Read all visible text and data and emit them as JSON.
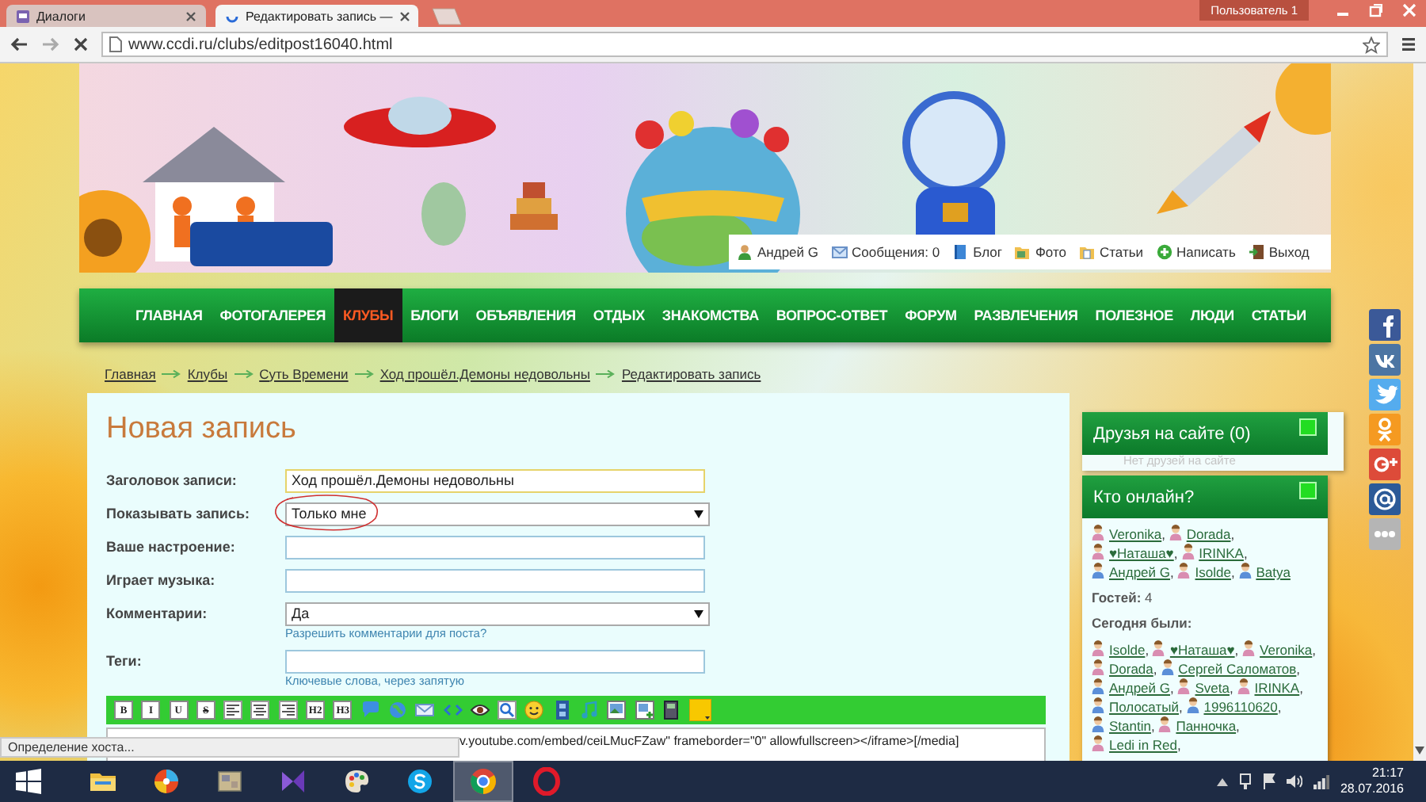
{
  "browser": {
    "tabs": [
      {
        "title": "Диалоги",
        "selected": false
      },
      {
        "title": "Редактировать запись —",
        "selected": true
      }
    ],
    "profile": "Пользователь 1",
    "url": "www.ccdi.ru/clubs/editpost16040.html"
  },
  "user_bar": [
    {
      "kind": "user",
      "label": "Андрей G"
    },
    {
      "kind": "messages",
      "label": "Сообщения: 0"
    },
    {
      "kind": "blog",
      "label": "Блог"
    },
    {
      "kind": "photo",
      "label": "Фото"
    },
    {
      "kind": "articles",
      "label": "Статьи"
    },
    {
      "kind": "write",
      "label": "Написать"
    },
    {
      "kind": "logout",
      "label": "Выход"
    }
  ],
  "nav": [
    {
      "label": "ГЛАВНАЯ",
      "selected": false
    },
    {
      "label": "ФОТОГАЛЕРЕЯ",
      "selected": false
    },
    {
      "label": "КЛУБЫ",
      "selected": true
    },
    {
      "label": "БЛОГИ",
      "selected": false
    },
    {
      "label": "ОБЪЯВЛЕНИЯ",
      "selected": false
    },
    {
      "label": "ОТДЫХ",
      "selected": false
    },
    {
      "label": "ЗНАКОМСТВА",
      "selected": false
    },
    {
      "label": "ВОПРОС-ОТВЕТ",
      "selected": false
    },
    {
      "label": "ФОРУМ",
      "selected": false
    },
    {
      "label": "РАЗВЛЕЧЕНИЯ",
      "selected": false
    },
    {
      "label": "ПОЛЕЗНОЕ",
      "selected": false
    },
    {
      "label": "ЛЮДИ",
      "selected": false
    },
    {
      "label": "СТАТЬИ",
      "selected": false
    }
  ],
  "breadcrumbs": [
    "Главная",
    "Клубы",
    "Суть Времени",
    "Ход прошёл.Демоны недовольны",
    "Редактировать запись"
  ],
  "form": {
    "title": "Новая запись",
    "fields": [
      {
        "kind": "text",
        "label": "Заголовок записи:",
        "value": "Ход прошёл.Демоны недовольны",
        "focused": true
      },
      {
        "kind": "select",
        "label": "Показывать запись:",
        "value": "Только мне",
        "circled": true
      },
      {
        "kind": "text",
        "label": "Ваше настроение:",
        "focused": false
      },
      {
        "kind": "text",
        "label": "Играет музыка:",
        "focused": false
      },
      {
        "kind": "select",
        "label": "Комментарии:",
        "value": "Да",
        "hint": "Разрешить комментарии для поста?",
        "circled": false
      },
      {
        "kind": "text",
        "label": "Теги:",
        "hint": "Ключевые слова, через запятую",
        "focused": false
      }
    ],
    "toolbar": [
      {
        "kind": "letter",
        "label": "B"
      },
      {
        "kind": "letter",
        "label": "I"
      },
      {
        "kind": "letter",
        "label": "U"
      },
      {
        "kind": "strike",
        "label": "S"
      },
      {
        "kind": "align-left"
      },
      {
        "kind": "align-center"
      },
      {
        "kind": "align-right"
      },
      {
        "kind": "letter",
        "label": "H2"
      },
      {
        "kind": "letter",
        "label": "H3"
      },
      {
        "kind": "quote"
      },
      {
        "kind": "link"
      },
      {
        "kind": "email"
      },
      {
        "kind": "code"
      },
      {
        "kind": "preview"
      },
      {
        "kind": "zoom"
      },
      {
        "kind": "smile"
      },
      {
        "kind": "video"
      },
      {
        "kind": "music"
      },
      {
        "kind": "image"
      },
      {
        "kind": "add-image"
      },
      {
        "kind": "file"
      },
      {
        "kind": "color"
      }
    ],
    "editor_text": "v.youtube.com/embed/ceiLMucFZaw\" frameborder=\"0\" allowfullscreen></iframe>[/media]"
  },
  "status": "Определение хоста...",
  "sidebar": {
    "friends": {
      "title": "Друзья на сайте (0)",
      "empty": "Нет друзей на сайте"
    },
    "online": {
      "title": "Кто онлайн?",
      "users": [
        {
          "name": "Veronika",
          "sep": ",",
          "kind": "female"
        },
        {
          "name": "Dorada",
          "sep": ",",
          "kind": "female"
        },
        {
          "name": "♥Наташа♥",
          "sep": ",",
          "kind": "female"
        },
        {
          "name": "IRINKA",
          "sep": ",",
          "kind": "female"
        },
        {
          "name": "Андрей G",
          "sep": ",",
          "kind": "male"
        },
        {
          "name": "Isolde",
          "sep": ",",
          "kind": "female"
        },
        {
          "name": "Batya",
          "kind": "male"
        }
      ],
      "guests": "**Гостей:** 4",
      "today_label": "Сегодня были:",
      "today": [
        {
          "name": "Isolde",
          "sep": ",",
          "kind": "female"
        },
        {
          "name": "♥Наташа♥",
          "sep": ",",
          "kind": "female"
        },
        {
          "name": "Veronika",
          "sep": ",",
          "kind": "female"
        },
        {
          "name": "Dorada",
          "sep": ",",
          "kind": "female"
        },
        {
          "name": "Сергей Саломатов",
          "sep": ",",
          "kind": "male"
        },
        {
          "name": "Андрей G",
          "sep": ",",
          "kind": "male"
        },
        {
          "name": "Sveta",
          "sep": ",",
          "kind": "female"
        },
        {
          "name": "IRINKA",
          "sep": ",",
          "kind": "female"
        },
        {
          "name": "Полосатый",
          "sep": ",",
          "kind": "male"
        },
        {
          "name": "1996110620",
          "sep": ",",
          "kind": "male"
        },
        {
          "name": "Stantin",
          "sep": ",",
          "kind": "male"
        },
        {
          "name": "Панночка",
          "sep": ",",
          "kind": "female"
        },
        {
          "name": "Ledi in Red",
          "sep": ",",
          "kind": "female"
        }
      ]
    }
  },
  "taskbar": {
    "apps": [
      {
        "kind": "folder",
        "selected": false
      },
      {
        "kind": "disc",
        "selected": false
      },
      {
        "kind": "archive",
        "selected": false
      },
      {
        "kind": "bow",
        "selected": false
      },
      {
        "kind": "palette",
        "selected": false
      },
      {
        "kind": "skype",
        "selected": false
      },
      {
        "kind": "chrome",
        "selected": true
      },
      {
        "kind": "opera",
        "selected": false
      }
    ],
    "time": "21:17",
    "date": "28.07.2016"
  }
}
